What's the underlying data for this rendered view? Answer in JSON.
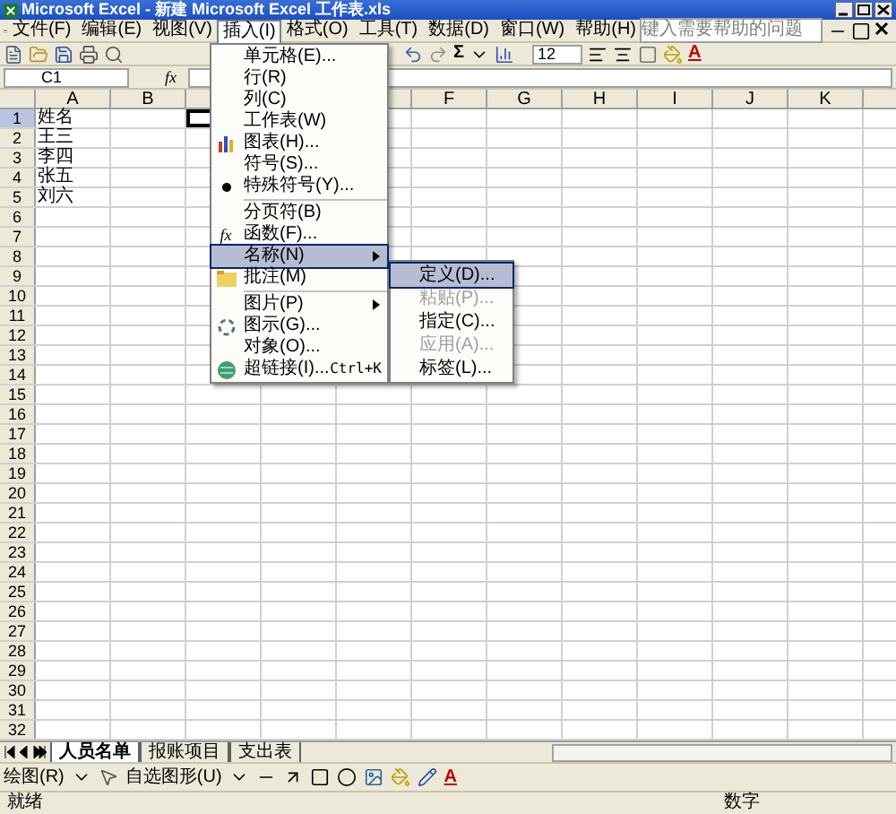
{
  "window": {
    "title": "Microsoft Excel - 新建 Microsoft Excel 工作表.xls"
  },
  "menu_bar": [
    {
      "label": "文件(F)",
      "selected": false
    },
    {
      "label": "编辑(E)",
      "selected": false
    },
    {
      "label": "视图(V)",
      "selected": false
    },
    {
      "label": "插入(I)",
      "selected": true
    },
    {
      "label": "格式(O)",
      "selected": false
    },
    {
      "label": "工具(T)",
      "selected": false
    },
    {
      "label": "数据(D)",
      "selected": false
    },
    {
      "label": "窗口(W)",
      "selected": false
    },
    {
      "label": "帮助(H)",
      "selected": false
    }
  ],
  "help_box": {
    "placeholder": "键入需要帮助的问题"
  },
  "toolbar": {
    "sum_glyph": "Σ",
    "font_size": "12",
    "font_color_glyph": "A"
  },
  "formula_bar": {
    "name_box": "C1",
    "fx_glyph": "fx"
  },
  "columns": [
    "A",
    "B",
    "F",
    "G",
    "H",
    "I",
    "J",
    "K"
  ],
  "rows": [
    {
      "header": "1",
      "cell": "姓名",
      "selected": true
    },
    {
      "header": "2",
      "cell": "王三",
      "selected": false
    },
    {
      "header": "3",
      "cell": "李四",
      "selected": false
    },
    {
      "header": "4",
      "cell": "张五",
      "selected": false
    },
    {
      "header": "5",
      "cell": "刘六",
      "selected": false
    },
    {
      "header": "6",
      "selected": false
    },
    {
      "header": "7",
      "selected": false
    },
    {
      "header": "8",
      "selected": false
    },
    {
      "header": "9",
      "selected": false
    },
    {
      "header": "10",
      "selected": false
    },
    {
      "header": "11",
      "selected": false
    },
    {
      "header": "12",
      "selected": false
    },
    {
      "header": "13",
      "selected": false
    },
    {
      "header": "14",
      "selected": false
    },
    {
      "header": "15",
      "selected": false
    },
    {
      "header": "16",
      "selected": false
    },
    {
      "header": "17",
      "selected": false
    },
    {
      "header": "18",
      "selected": false
    },
    {
      "header": "19",
      "selected": false
    },
    {
      "header": "20",
      "selected": false
    },
    {
      "header": "21",
      "selected": false
    },
    {
      "header": "22",
      "selected": false
    },
    {
      "header": "23",
      "selected": false
    },
    {
      "header": "24",
      "selected": false
    },
    {
      "header": "25",
      "selected": false
    },
    {
      "header": "26",
      "selected": false
    },
    {
      "header": "27",
      "selected": false
    },
    {
      "header": "28",
      "selected": false
    },
    {
      "header": "29",
      "selected": false
    },
    {
      "header": "30",
      "selected": false
    },
    {
      "header": "31",
      "selected": false
    },
    {
      "header": "32",
      "selected": false
    }
  ],
  "insert_menu": [
    {
      "kind": "item",
      "label": "单元格(E)...",
      "selected": false
    },
    {
      "kind": "item",
      "label": "行(R)",
      "selected": false
    },
    {
      "kind": "item",
      "label": "列(C)",
      "selected": false
    },
    {
      "kind": "item",
      "label": "工作表(W)",
      "selected": false
    },
    {
      "kind": "item",
      "label": "图表(H)...",
      "selected": false
    },
    {
      "kind": "item",
      "label": "符号(S)...",
      "selected": false
    },
    {
      "kind": "item",
      "label": "特殊符号(Y)...",
      "selected": false
    },
    {
      "kind": "separator"
    },
    {
      "kind": "item",
      "label": "分页符(B)",
      "selected": false
    },
    {
      "kind": "item",
      "label": "函数(F)...",
      "selected": false,
      "glyph": "fx"
    },
    {
      "kind": "submenu",
      "label": "名称(N)",
      "selected": true
    },
    {
      "kind": "item",
      "label": "批注(M)",
      "selected": false
    },
    {
      "kind": "separator"
    },
    {
      "kind": "submenu",
      "label": "图片(P)",
      "selected": false
    },
    {
      "kind": "item",
      "label": "图示(G)...",
      "selected": false
    },
    {
      "kind": "item",
      "label": "对象(O)...",
      "selected": false
    },
    {
      "kind": "item",
      "label": "超链接(I)...",
      "shortcut": "Ctrl+K",
      "selected": false
    }
  ],
  "name_submenu": [
    {
      "label": "定义(D)...",
      "selected": true,
      "disabled": false
    },
    {
      "label": "粘贴(P)...",
      "selected": false,
      "disabled": true
    },
    {
      "label": "指定(C)...",
      "selected": false,
      "disabled": false
    },
    {
      "label": "应用(A)...",
      "selected": false,
      "disabled": true
    },
    {
      "label": "标签(L)...",
      "selected": false,
      "disabled": false
    }
  ],
  "sheet_tabs": [
    {
      "label": "人员名单",
      "selected": true
    },
    {
      "label": "报账项目",
      "selected": false
    },
    {
      "label": "支出表",
      "selected": false
    }
  ],
  "drawing_toolbar": {
    "draw_menu": "绘图(R)",
    "autoshapes_menu": "自选图形(U)",
    "font_color_glyph": "A"
  },
  "status_bar": {
    "left": "就绪",
    "right": "数字"
  }
}
